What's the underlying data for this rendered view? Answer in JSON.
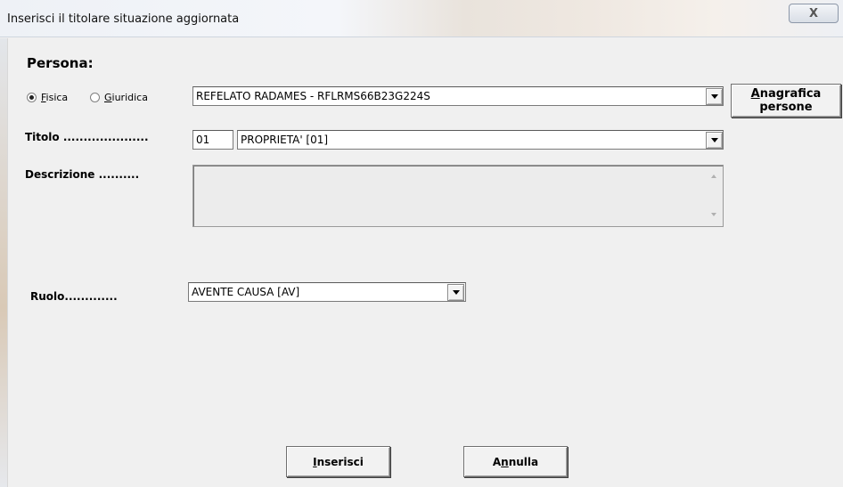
{
  "window": {
    "title": "Inserisci il titolare situazione aggiornata",
    "close_symbol": "X"
  },
  "persona": {
    "heading": "Persona:",
    "radio_fisica": {
      "prefix": "",
      "accel": "F",
      "rest": "isica",
      "selected": true
    },
    "radio_giuridica": {
      "prefix": "",
      "accel": "G",
      "rest": "iuridica",
      "selected": false
    },
    "selected_value": "REFELATO RADAMES - RFLRMS66B23G224S",
    "anagrafica_button": {
      "accel": "A",
      "line1_rest": "nagrafica",
      "line2": "persone"
    }
  },
  "titolo": {
    "label": "Titolo .....................",
    "code": "01",
    "selected_value": "PROPRIETA' [01]"
  },
  "descrizione": {
    "label": "Descrizione ..........",
    "value": ""
  },
  "ruolo": {
    "label": "Ruolo.............",
    "selected_value": "AVENTE CAUSA [AV]"
  },
  "buttons": {
    "inserisci": {
      "accel": "I",
      "rest": "nserisci"
    },
    "annulla": {
      "prefix": "A",
      "accel": "n",
      "rest": "nulla"
    }
  },
  "icons": {
    "close": "close-icon",
    "dropdown": "chevron-down-icon",
    "scroll_up": "scroll-up-icon",
    "scroll_down": "scroll-down-icon"
  }
}
